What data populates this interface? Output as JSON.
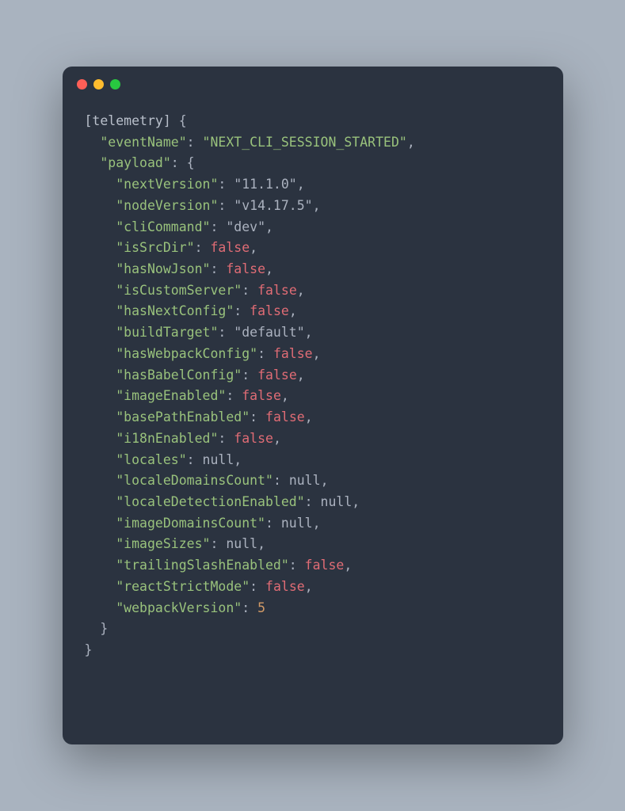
{
  "window": {
    "traffic_lights": [
      "close",
      "minimize",
      "zoom"
    ]
  },
  "code": {
    "tag": "[telemetry]",
    "open_brace": " {",
    "lines": [
      {
        "indent": 1,
        "key": "eventName",
        "colon": ": ",
        "val": "\"NEXT_CLI_SESSION_STARTED\"",
        "type": "key-str",
        "trail": ","
      },
      {
        "indent": 1,
        "key": "payload",
        "colon": ": {",
        "type": "key-open",
        "trail": ""
      },
      {
        "indent": 2,
        "key": "nextVersion",
        "colon": ": ",
        "val": "\"11.1.0\"",
        "type": "str",
        "trail": ","
      },
      {
        "indent": 2,
        "key": "nodeVersion",
        "colon": ": ",
        "val": "\"v14.17.5\"",
        "type": "str",
        "trail": ","
      },
      {
        "indent": 2,
        "key": "cliCommand",
        "colon": ": ",
        "val": "\"dev\"",
        "type": "str",
        "trail": ","
      },
      {
        "indent": 2,
        "key": "isSrcDir",
        "colon": ": ",
        "val": "false",
        "type": "bool",
        "trail": ","
      },
      {
        "indent": 2,
        "key": "hasNowJson",
        "colon": ": ",
        "val": "false",
        "type": "bool",
        "trail": ","
      },
      {
        "indent": 2,
        "key": "isCustomServer",
        "colon": ": ",
        "val": "false",
        "type": "bool",
        "trail": ","
      },
      {
        "indent": 2,
        "key": "hasNextConfig",
        "colon": ": ",
        "val": "false",
        "type": "bool",
        "trail": ","
      },
      {
        "indent": 2,
        "key": "buildTarget",
        "colon": ": ",
        "val": "\"default\"",
        "type": "str",
        "trail": ","
      },
      {
        "indent": 2,
        "key": "hasWebpackConfig",
        "colon": ": ",
        "val": "false",
        "type": "bool",
        "trail": ","
      },
      {
        "indent": 2,
        "key": "hasBabelConfig",
        "colon": ": ",
        "val": "false",
        "type": "bool",
        "trail": ","
      },
      {
        "indent": 2,
        "key": "imageEnabled",
        "colon": ": ",
        "val": "false",
        "type": "bool",
        "trail": ","
      },
      {
        "indent": 2,
        "key": "basePathEnabled",
        "colon": ": ",
        "val": "false",
        "type": "bool",
        "trail": ","
      },
      {
        "indent": 2,
        "key": "i18nEnabled",
        "colon": ": ",
        "val": "false",
        "type": "bool",
        "trail": ","
      },
      {
        "indent": 2,
        "key": "locales",
        "colon": ": ",
        "val": "null",
        "type": "null",
        "trail": ","
      },
      {
        "indent": 2,
        "key": "localeDomainsCount",
        "colon": ": ",
        "val": "null",
        "type": "null",
        "trail": ","
      },
      {
        "indent": 2,
        "key": "localeDetectionEnabled",
        "colon": ": ",
        "val": "null",
        "type": "null",
        "trail": ","
      },
      {
        "indent": 2,
        "key": "imageDomainsCount",
        "colon": ": ",
        "val": "null",
        "type": "null",
        "trail": ","
      },
      {
        "indent": 2,
        "key": "imageSizes",
        "colon": ": ",
        "val": "null",
        "type": "null",
        "trail": ","
      },
      {
        "indent": 2,
        "key": "trailingSlashEnabled",
        "colon": ": ",
        "val": "false",
        "type": "bool",
        "trail": ","
      },
      {
        "indent": 2,
        "key": "reactStrictMode",
        "colon": ": ",
        "val": "false",
        "type": "bool",
        "trail": ","
      },
      {
        "indent": 2,
        "key": "webpackVersion",
        "colon": ": ",
        "val": "5",
        "type": "num",
        "trail": ""
      }
    ],
    "close1_indent": 1,
    "close1": "}",
    "close2_indent": 0,
    "close2": "}"
  }
}
